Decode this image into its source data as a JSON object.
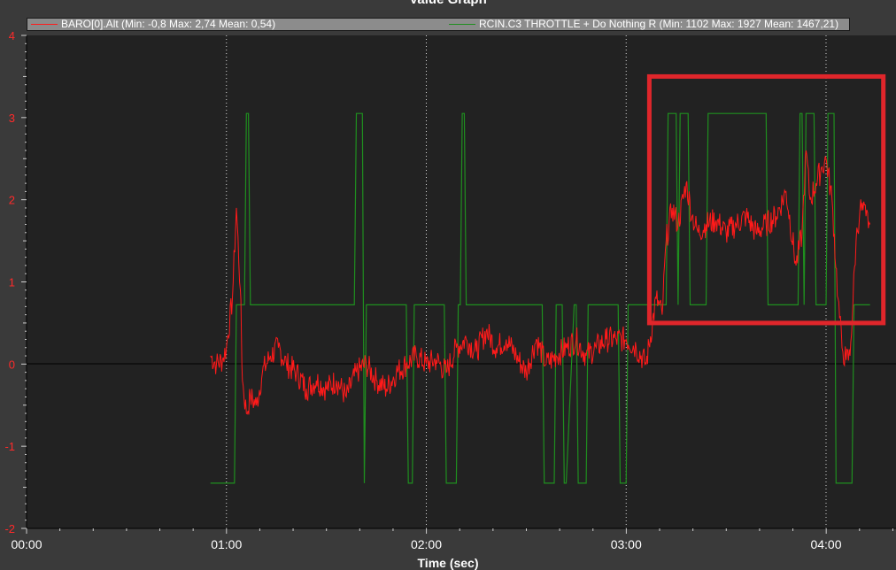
{
  "window": {
    "title": "Value Graph",
    "x_axis_title": "Time (sec)"
  },
  "colors": {
    "background": "#3a3a3a",
    "plot_background": "#222222",
    "series_baro": "#ff1a1a",
    "series_throttle": "#1f8f1f",
    "highlight_box": "#e0262b",
    "y_tick_text": "#ff2a2a",
    "x_tick_text": "#ffffff"
  },
  "chart_data": {
    "type": "line",
    "title": "Value Graph",
    "xlabel": "Time (sec)",
    "ylabel": "",
    "xlim": [
      0,
      4.35
    ],
    "ylim": [
      -2,
      4
    ],
    "x_ticks": [
      "00:00",
      "01:00",
      "02:00",
      "03:00",
      "04:00"
    ],
    "x_tick_values": [
      0,
      1,
      2,
      3,
      4
    ],
    "y_ticks": [
      "4",
      "3",
      "2",
      "1",
      "0",
      "-1",
      "-2"
    ],
    "y_tick_values": [
      4,
      3,
      2,
      1,
      0,
      -1,
      -2
    ],
    "grid": "vertical dotted lines at x ticks",
    "legend_position": "top",
    "series": [
      {
        "name": "BARO[0].Alt",
        "legend": "BARO[0].Alt  (Min: -0,8 Max: 2,74 Mean: 0,54)",
        "color": "#ff1a1a",
        "x": [
          0.92,
          0.95,
          0.98,
          1.0,
          1.03,
          1.05,
          1.07,
          1.08,
          1.1,
          1.12,
          1.15,
          1.18,
          1.22,
          1.26,
          1.3,
          1.35,
          1.4,
          1.45,
          1.5,
          1.55,
          1.6,
          1.65,
          1.7,
          1.75,
          1.8,
          1.85,
          1.9,
          1.95,
          2.0,
          2.05,
          2.1,
          2.15,
          2.2,
          2.25,
          2.3,
          2.35,
          2.4,
          2.45,
          2.5,
          2.55,
          2.6,
          2.65,
          2.7,
          2.75,
          2.8,
          2.85,
          2.9,
          2.95,
          3.0,
          3.05,
          3.1,
          3.15,
          3.18,
          3.2,
          3.23,
          3.26,
          3.3,
          3.33,
          3.36,
          3.4,
          3.45,
          3.5,
          3.55,
          3.6,
          3.65,
          3.7,
          3.75,
          3.8,
          3.85,
          3.88,
          3.9,
          3.92,
          3.95,
          3.98,
          4.0,
          4.03,
          4.06,
          4.08,
          4.1,
          4.12,
          4.15,
          4.17,
          4.2,
          4.22
        ],
        "y": [
          0.1,
          0.0,
          0.05,
          0.2,
          0.8,
          1.9,
          0.9,
          -0.2,
          -0.6,
          -0.4,
          -0.5,
          -0.1,
          0.1,
          0.2,
          0.0,
          -0.1,
          -0.3,
          -0.2,
          -0.3,
          -0.2,
          -0.4,
          -0.1,
          0.0,
          -0.2,
          -0.3,
          -0.1,
          0.0,
          0.1,
          0.0,
          0.05,
          -0.1,
          0.2,
          0.3,
          0.15,
          0.4,
          0.2,
          0.3,
          0.1,
          -0.1,
          0.3,
          0.0,
          0.1,
          0.2,
          0.3,
          0.1,
          0.2,
          0.3,
          0.3,
          0.3,
          0.2,
          0.0,
          0.8,
          0.6,
          1.5,
          1.9,
          1.7,
          2.2,
          1.8,
          1.6,
          1.7,
          1.75,
          1.6,
          1.7,
          1.8,
          1.6,
          1.7,
          1.8,
          2.1,
          1.2,
          1.6,
          2.6,
          2.0,
          2.2,
          2.4,
          2.5,
          2.0,
          0.8,
          0.2,
          0.05,
          0.1,
          1.5,
          1.9,
          1.8,
          1.7
        ]
      },
      {
        "name": "RCIN.C3 THROTTLE + Do Nothing R",
        "legend": "RCIN.C3 THROTTLE + Do Nothing R (Min: 1102 Max: 1927 Mean: 1467,21)",
        "color": "#1f8f1f",
        "x": [
          0.92,
          1.04,
          1.05,
          1.08,
          1.09,
          1.1,
          1.11,
          1.12,
          1.13,
          1.64,
          1.65,
          1.68,
          1.69,
          1.7,
          1.71,
          1.9,
          1.91,
          1.93,
          1.94,
          1.95,
          2.09,
          2.1,
          2.15,
          2.16,
          2.17,
          2.18,
          2.19,
          2.2,
          2.58,
          2.59,
          2.64,
          2.65,
          2.68,
          2.69,
          2.7,
          2.74,
          2.75,
          2.76,
          2.8,
          2.81,
          2.82,
          2.96,
          2.97,
          3.0,
          3.01,
          3.2,
          3.21,
          3.25,
          3.26,
          3.27,
          3.31,
          3.32,
          3.4,
          3.41,
          3.43,
          3.44,
          3.7,
          3.71,
          3.86,
          3.87,
          3.88,
          3.89,
          3.9,
          3.91,
          3.94,
          3.95,
          4.0,
          4.01,
          4.04,
          4.05,
          4.06,
          4.13,
          4.14,
          4.22
        ],
        "y": [
          1102,
          1102,
          1500,
          1500,
          1500,
          1927,
          1927,
          1500,
          1500,
          1500,
          1927,
          1927,
          1102,
          1500,
          1500,
          1500,
          1102,
          1102,
          1500,
          1500,
          1500,
          1102,
          1102,
          1500,
          1500,
          1927,
          1927,
          1500,
          1500,
          1102,
          1102,
          1500,
          1500,
          1102,
          1102,
          1500,
          1500,
          1102,
          1102,
          1500,
          1500,
          1500,
          1102,
          1102,
          1500,
          1500,
          1927,
          1927,
          1500,
          1927,
          1927,
          1500,
          1500,
          1927,
          1927,
          1927,
          1927,
          1500,
          1500,
          1927,
          1927,
          1500,
          1927,
          1927,
          1927,
          1500,
          1500,
          1927,
          1927,
          1102,
          1102,
          1102,
          1500,
          1500
        ]
      }
    ],
    "annotations": [
      {
        "type": "highlight-rectangle",
        "x_range": [
          3.2,
          4.3
        ],
        "y_range": [
          0.5,
          3.5
        ],
        "color": "#e0262b"
      }
    ]
  },
  "legend": {
    "baro": "BARO[0].Alt  (Min: -0,8 Max: 2,74 Mean: 0,54)",
    "throttle": "RCIN.C3 THROTTLE + Do Nothing R (Min: 1102 Max: 1927 Mean: 1467,21)"
  }
}
